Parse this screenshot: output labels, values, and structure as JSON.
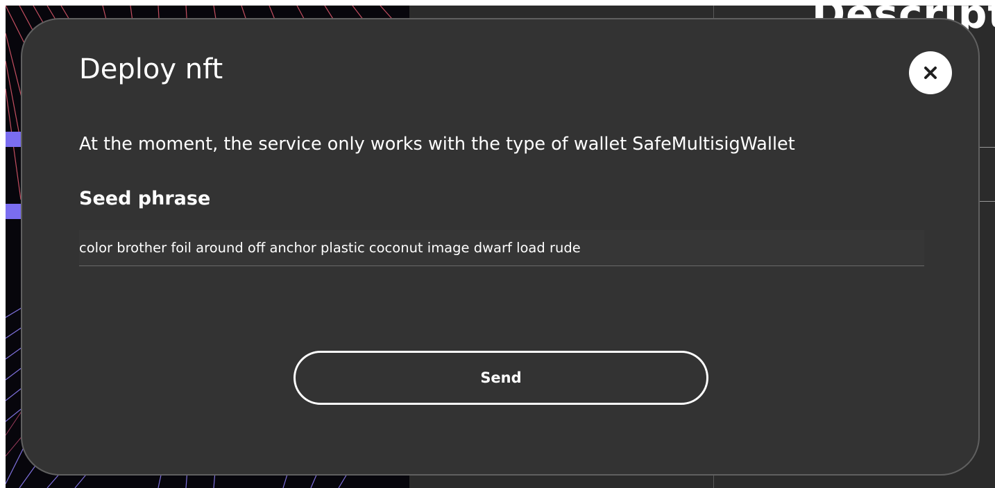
{
  "background": {
    "heading_fragment": "Descripti"
  },
  "modal": {
    "title": "Deploy nft",
    "close_label": "×",
    "notice": "At the moment, the service only works with the type of wallet SafeMultisigWallet",
    "seed_label": "Seed phrase",
    "seed_value": "color brother foil around off anchor plastic coconut image dwarf load rude",
    "send_label": "Send"
  },
  "colors": {
    "modal_bg": "#333333",
    "overlay_art_accent": "#7a6df0",
    "text": "#ffffff"
  }
}
